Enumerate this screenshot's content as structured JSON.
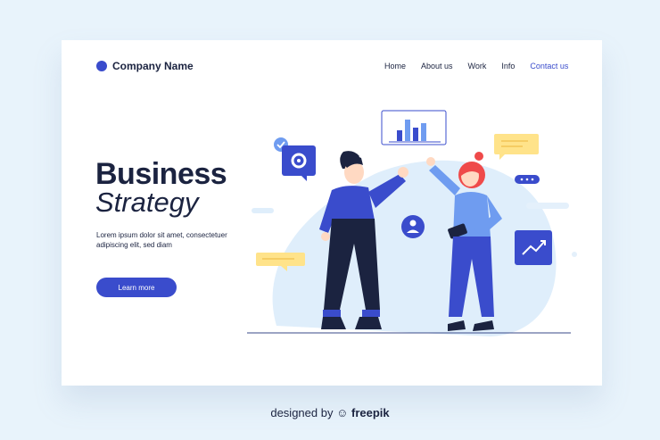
{
  "header": {
    "company_name": "Company Name",
    "nav": [
      {
        "label": "Home"
      },
      {
        "label": "About us"
      },
      {
        "label": "Work"
      },
      {
        "label": "Info"
      },
      {
        "label": "Contact us"
      }
    ],
    "active_nav": "Contact us"
  },
  "hero": {
    "title": "Business",
    "subtitle": "Strategy",
    "description": "Lorem ipsum dolor sit amet, consectetuer adipiscing elit, sed diam",
    "cta_label": "Learn more"
  },
  "footer": {
    "prefix": "designed by",
    "brand": "freepik"
  },
  "colors": {
    "page_bg": "#e8f3fb",
    "accent": "#3a4ccc",
    "text": "#1b2340",
    "yellow": "#ffe38a",
    "light_blue": "#dfeefb"
  },
  "icons": [
    "gear-icon",
    "check-icon",
    "user-icon",
    "trend-chart-icon",
    "bar-chart-icon",
    "chat-bubble-icon"
  ]
}
